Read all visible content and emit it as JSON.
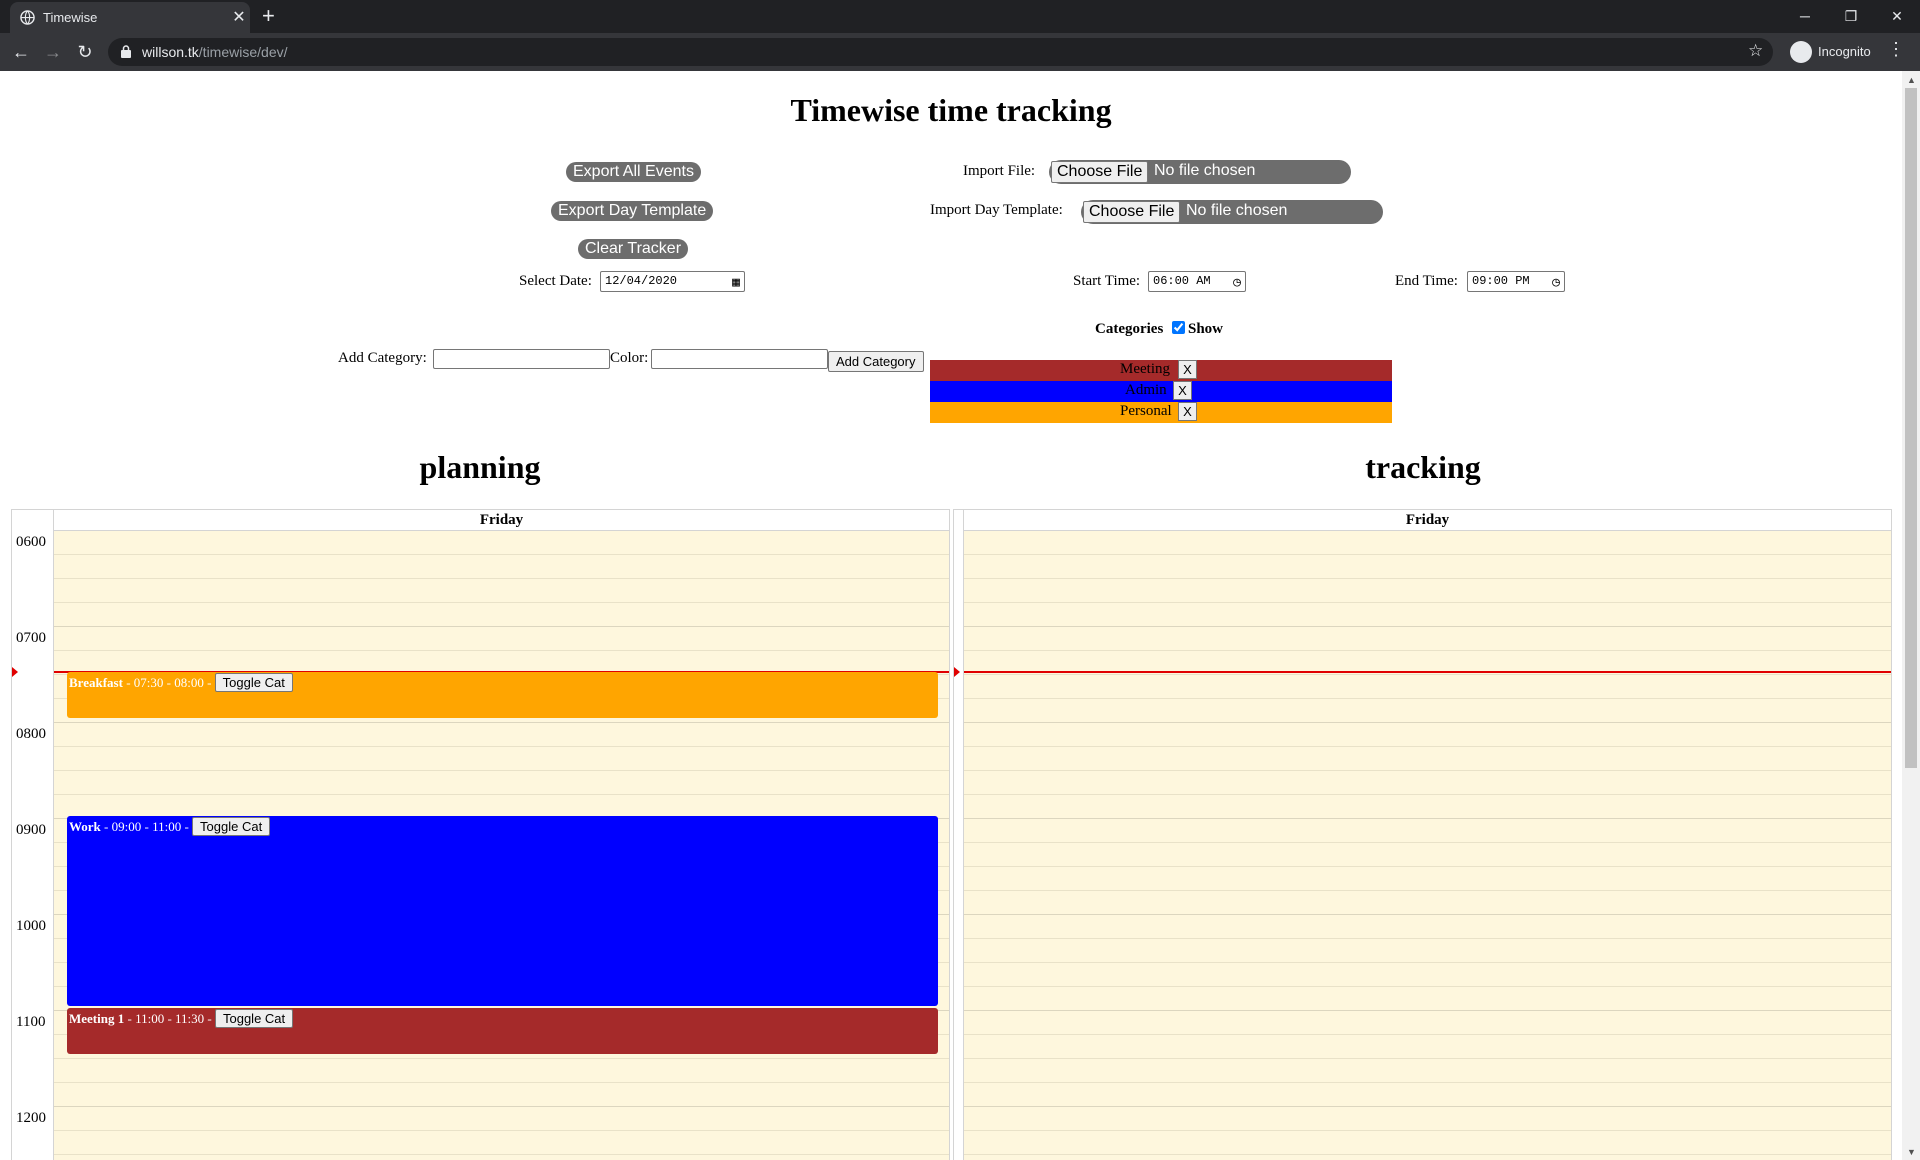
{
  "browser": {
    "tab_title": "Timewise",
    "tab_close": "✕",
    "new_tab": "+",
    "url_host": "willson.tk",
    "url_path": "/timewise/dev/",
    "incognito_label": "Incognito",
    "window_controls": {
      "minimize": "─",
      "restore": "❐",
      "close": "✕"
    },
    "nav": {
      "back": "←",
      "forward": "→",
      "reload": "↻"
    },
    "star_icon": "☆",
    "menu_icon": "⋮"
  },
  "page": {
    "title": "Timewise time tracking",
    "buttons": {
      "export_all": "Export All Events",
      "export_day_template": "Export Day Template",
      "clear_tracker": "Clear Tracker"
    },
    "import_file": {
      "label": "Import File:",
      "choose": "Choose File",
      "status": "No file chosen"
    },
    "import_day_template": {
      "label": "Import Day Template:",
      "choose": "Choose File",
      "status": "No file chosen"
    },
    "select_date": {
      "label": "Select Date:",
      "value": "12/04/2020"
    },
    "start_time": {
      "label": "Start Time:",
      "value": "06:00 AM"
    },
    "end_time": {
      "label": "End Time:",
      "value": "09:00 PM"
    },
    "add_category": {
      "label": "Add Category:",
      "color_label": "Color:",
      "button": "Add Category",
      "name_value": "",
      "color_value": ""
    },
    "categories": {
      "heading": "Categories",
      "show_label": "Show",
      "show_checked": true,
      "remove_label": "X",
      "items": [
        {
          "name": "Meeting",
          "color": "#a52a2a"
        },
        {
          "name": "Admin",
          "color": "#0000ff"
        },
        {
          "name": "Personal",
          "color": "#ffa500"
        }
      ]
    },
    "planning": {
      "title": "planning",
      "day": "Friday",
      "hours": [
        "0600",
        "0700",
        "0800",
        "0900",
        "1000",
        "1100",
        "1200"
      ],
      "events": [
        {
          "name": "Breakfast",
          "time": "- 07:30 - 08:00 -",
          "toggle": "Toggle Cat",
          "color": "#ffa500"
        },
        {
          "name": "Work",
          "time": "- 09:00 - 11:00 -",
          "toggle": "Toggle Cat",
          "color": "#0000ff"
        },
        {
          "name": "Meeting 1",
          "time": "- 11:00 - 11:30 -",
          "toggle": "Toggle Cat",
          "color": "#a52a2a"
        }
      ]
    },
    "tracking": {
      "title": "tracking",
      "day": "Friday"
    }
  }
}
